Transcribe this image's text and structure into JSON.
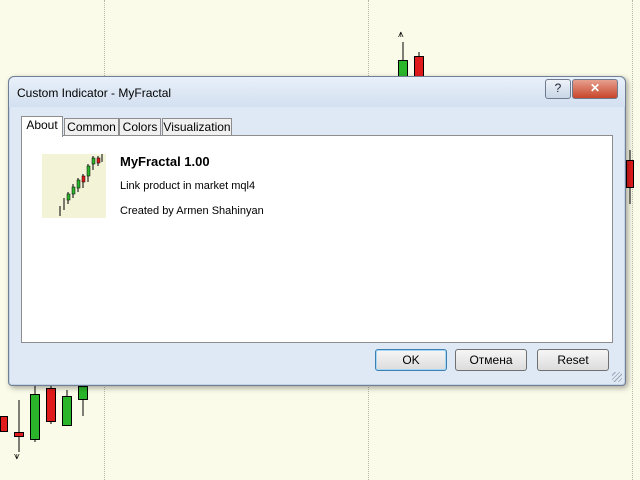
{
  "dialog": {
    "title": "Custom Indicator - MyFractal",
    "help_label": "?",
    "close_label": "✕"
  },
  "tabs": [
    {
      "label": "About"
    },
    {
      "label": "Common"
    },
    {
      "label": "Colors"
    },
    {
      "label": "Visualization"
    }
  ],
  "about": {
    "name": "MyFractal 1.00",
    "link_text": "Link product in market mql4",
    "author_text": "Created by Armen Shahinyan"
  },
  "buttons": {
    "ok": "OK",
    "cancel": "Отмена",
    "reset": "Reset"
  },
  "colors": {
    "bull": "#2bb52b",
    "bear": "#e01b1b",
    "chart_bg": "#fbfbe9"
  }
}
